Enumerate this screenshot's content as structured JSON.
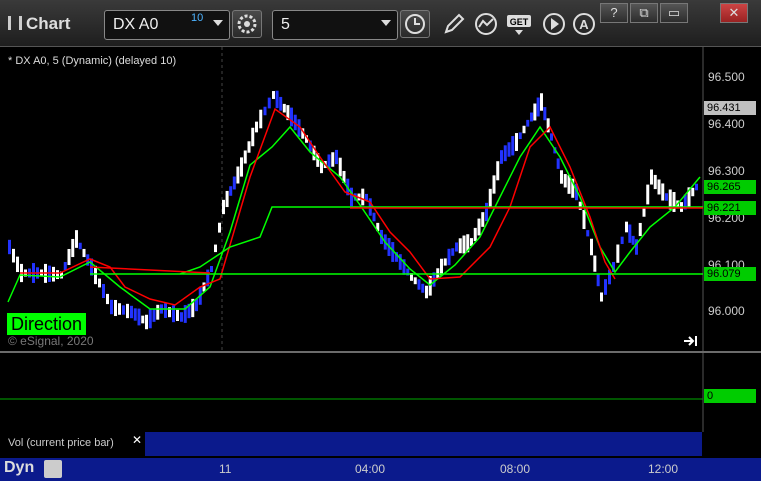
{
  "window": {
    "title": "Chart",
    "symbol": "DX A0",
    "symbol_superscript": "10",
    "interval": "5",
    "get_label": "GET",
    "controls": [
      "?",
      "⧉",
      "▭",
      "✕"
    ]
  },
  "chart": {
    "legend": "* DX A0, 5 (Dynamic) (delayed 10)",
    "direction_label": "Direction",
    "copyright": "© eSignal, 2020",
    "price_axis": [
      "96.500",
      "96.400",
      "96.300",
      "96.200",
      "96.100",
      "96.000"
    ],
    "price_tags": [
      {
        "value": "96.431",
        "bg": "#c0c0c0",
        "fg": "#000000"
      },
      {
        "value": "96.265",
        "bg": "#00cc00",
        "fg": "#000000"
      },
      {
        "value": "96.221",
        "bg": "#00cc00",
        "fg": "#000000"
      },
      {
        "value": "96.079",
        "bg": "#00cc00",
        "fg": "#000000"
      }
    ],
    "volume_tag": "0",
    "volume_pane_label": "Vol (current price bar)",
    "time_axis": [
      "11",
      "04:00",
      "08:00",
      "12:00"
    ],
    "status_label": "Dyn",
    "colors": {
      "up_bar": "#ffffff",
      "down_bar": "#2233ff",
      "fast_line": "#00ff00",
      "slow_line": "#ff0000",
      "background": "#000000"
    }
  }
}
